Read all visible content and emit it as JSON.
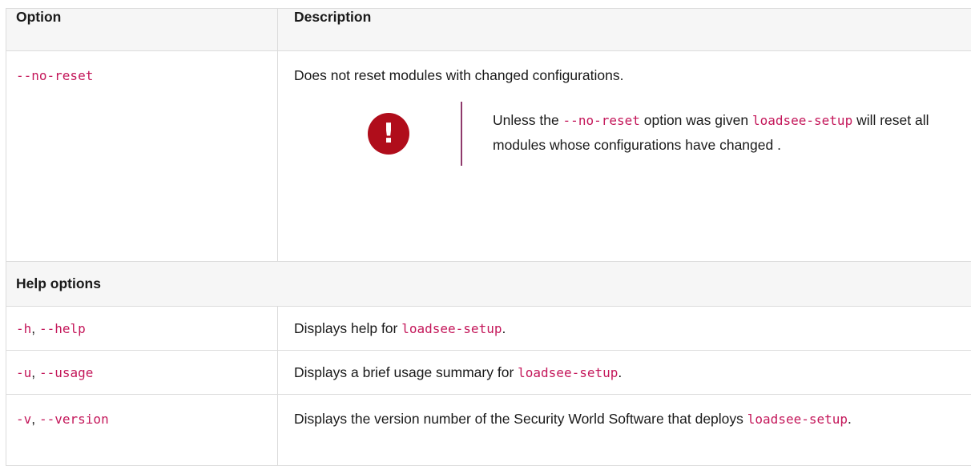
{
  "table": {
    "headers": {
      "option": "Option",
      "description": "Description"
    },
    "no_reset": {
      "option": "--no-reset",
      "description": "Does not reset modules with changed configurations.",
      "note": {
        "pre": "Unless the ",
        "code1": "--no-reset",
        "mid": " option was given ",
        "code2": "loadsee-setup",
        "post": " will reset all modules whose configurations have changed ."
      }
    },
    "help_section": "Help options",
    "help": {
      "opt_short": "-h",
      "sep": ", ",
      "opt_long": "--help",
      "pre": "Displays help for ",
      "code": "loadsee-setup",
      "post": "."
    },
    "usage": {
      "opt_short": "-u",
      "sep": ", ",
      "opt_long": "--usage",
      "pre": "Displays a brief usage summary for ",
      "code": "loadsee-setup",
      "post": "."
    },
    "version": {
      "opt_short": "-v",
      "sep": ", ",
      "opt_long": "--version",
      "pre": "Displays the version number of the Security World Software that deploys ",
      "code": "loadsee-setup",
      "post": "."
    }
  },
  "icons": {
    "warning": "exclamation-circle-icon",
    "warning_color": "#b00d1b",
    "code_color": "#c4175a"
  }
}
